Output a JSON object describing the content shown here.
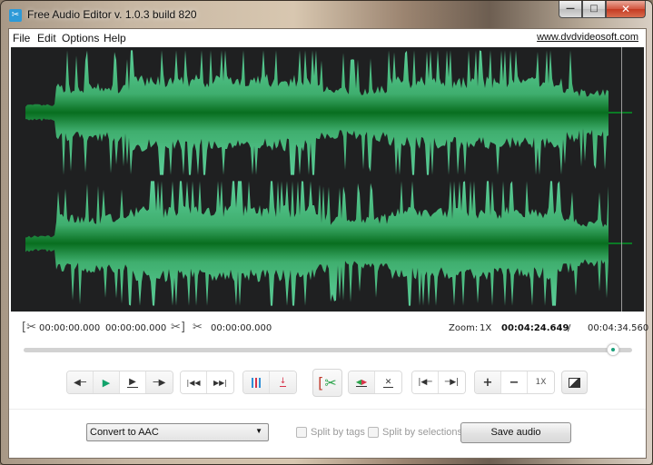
{
  "window": {
    "title": "Free Audio Editor v. 1.0.3 build 820",
    "controls": {
      "minimize": "—",
      "maximize": "□",
      "close": "✕"
    }
  },
  "menu": {
    "items": [
      "File",
      "Edit",
      "Options",
      "Help"
    ],
    "site_link": "www.dvdvideosoft.com"
  },
  "waveform": {
    "channels": 2,
    "colors": {
      "background": "#1f2021",
      "core": "#0b7a25",
      "peak": "#4fc48f",
      "cursor": "#9a9a9a"
    },
    "playhead_fraction": 0.964
  },
  "times": {
    "selection_start": "00:00:00.000",
    "selection_end": "00:00:00.000",
    "selection_length": "00:00:00.000",
    "zoom_label": "Zoom:",
    "zoom_value": "1X",
    "current_time": "00:04:24.649",
    "separator": "/",
    "total_time": "00:04:34.560"
  },
  "position_slider": {
    "value_fraction": 0.968
  },
  "toolbar": {
    "transport": [
      {
        "name": "step-back",
        "glyph": "🡐"
      },
      {
        "name": "play",
        "glyph": "▶"
      },
      {
        "name": "play-selection",
        "glyph": "▶"
      },
      {
        "name": "step-forward",
        "glyph": "🡒"
      }
    ],
    "navigation": [
      {
        "name": "go-to-start",
        "glyph": "⏮"
      },
      {
        "name": "go-to-end",
        "glyph": "⏭"
      }
    ],
    "zoom_reset_label": "1X",
    "zoom_in_glyph": "+",
    "zoom_out_glyph": "−"
  },
  "bottom": {
    "format_select": "Convert to AAC",
    "split_by_tags": "Split by tags",
    "split_by_selections": "Split by selections",
    "save_button": "Save audio"
  }
}
